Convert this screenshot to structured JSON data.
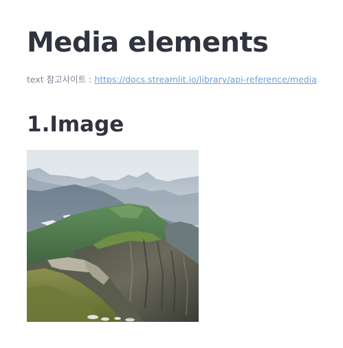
{
  "page": {
    "title": "Media elements",
    "caption_prefix": "text 참고사이트 : ",
    "reference_link": "https://docs.streamlit.io/library/api-reference/media"
  },
  "sections": [
    {
      "heading": "1.Image",
      "image_subject": "mountain-landscape-image"
    }
  ],
  "colors": {
    "text": "#31333f",
    "caption": "#808495",
    "link": "#6b9fd4",
    "background": "#ffffff"
  }
}
